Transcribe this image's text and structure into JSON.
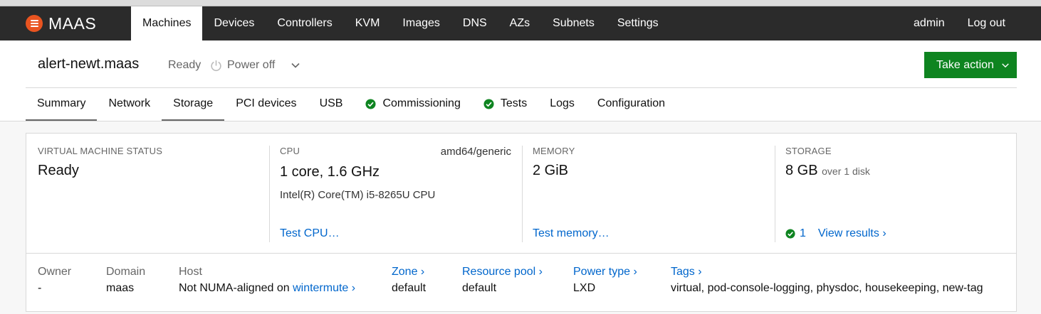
{
  "brand": {
    "name": "MAAS",
    "color": "#e95420"
  },
  "nav": {
    "items": [
      {
        "label": "Machines",
        "active": true
      },
      {
        "label": "Devices"
      },
      {
        "label": "Controllers"
      },
      {
        "label": "KVM"
      },
      {
        "label": "Images"
      },
      {
        "label": "DNS"
      },
      {
        "label": "AZs"
      },
      {
        "label": "Subnets"
      },
      {
        "label": "Settings"
      }
    ],
    "user": "admin",
    "logout": "Log out"
  },
  "machine": {
    "name": "alert-newt.maas",
    "status": "Ready",
    "power": "Power off",
    "take_action": "Take action"
  },
  "tabs": [
    {
      "label": "Summary",
      "active": true
    },
    {
      "label": "Network"
    },
    {
      "label": "Storage",
      "active": true
    },
    {
      "label": "PCI devices"
    },
    {
      "label": "USB"
    },
    {
      "label": "Commissioning",
      "check": true
    },
    {
      "label": "Tests",
      "check": true
    },
    {
      "label": "Logs"
    },
    {
      "label": "Configuration"
    }
  ],
  "summary": {
    "vm_status": {
      "label": "VIRTUAL MACHINE STATUS",
      "value": "Ready"
    },
    "cpu": {
      "label": "CPU",
      "arch": "amd64/generic",
      "value": "1 core, 1.6 GHz",
      "model": "Intel(R) Core(TM) i5-8265U CPU",
      "link": "Test CPU…"
    },
    "memory": {
      "label": "MEMORY",
      "value": "2 GiB",
      "link": "Test memory…"
    },
    "storage": {
      "label": "STORAGE",
      "value": "8 GB",
      "sub": "over 1 disk",
      "passed": "1",
      "link": "View results ›"
    }
  },
  "meta": {
    "owner": {
      "label": "Owner",
      "value": "-"
    },
    "domain": {
      "label": "Domain",
      "value": "maas"
    },
    "host": {
      "label": "Host",
      "value": "Not NUMA-aligned on",
      "link": "wintermute ›"
    },
    "zone": {
      "label": "Zone ›",
      "value": "default"
    },
    "pool": {
      "label": "Resource pool ›",
      "value": "default"
    },
    "power_type": {
      "label": "Power type ›",
      "value": "LXD"
    },
    "tags": {
      "label": "Tags ›",
      "value": "virtual, pod-console-logging, physdoc, housekeeping, new-tag"
    }
  },
  "colors": {
    "navbar": "#2b2b2b",
    "action": "#0e8420",
    "link": "#0066cc",
    "success": "#0e8420"
  }
}
